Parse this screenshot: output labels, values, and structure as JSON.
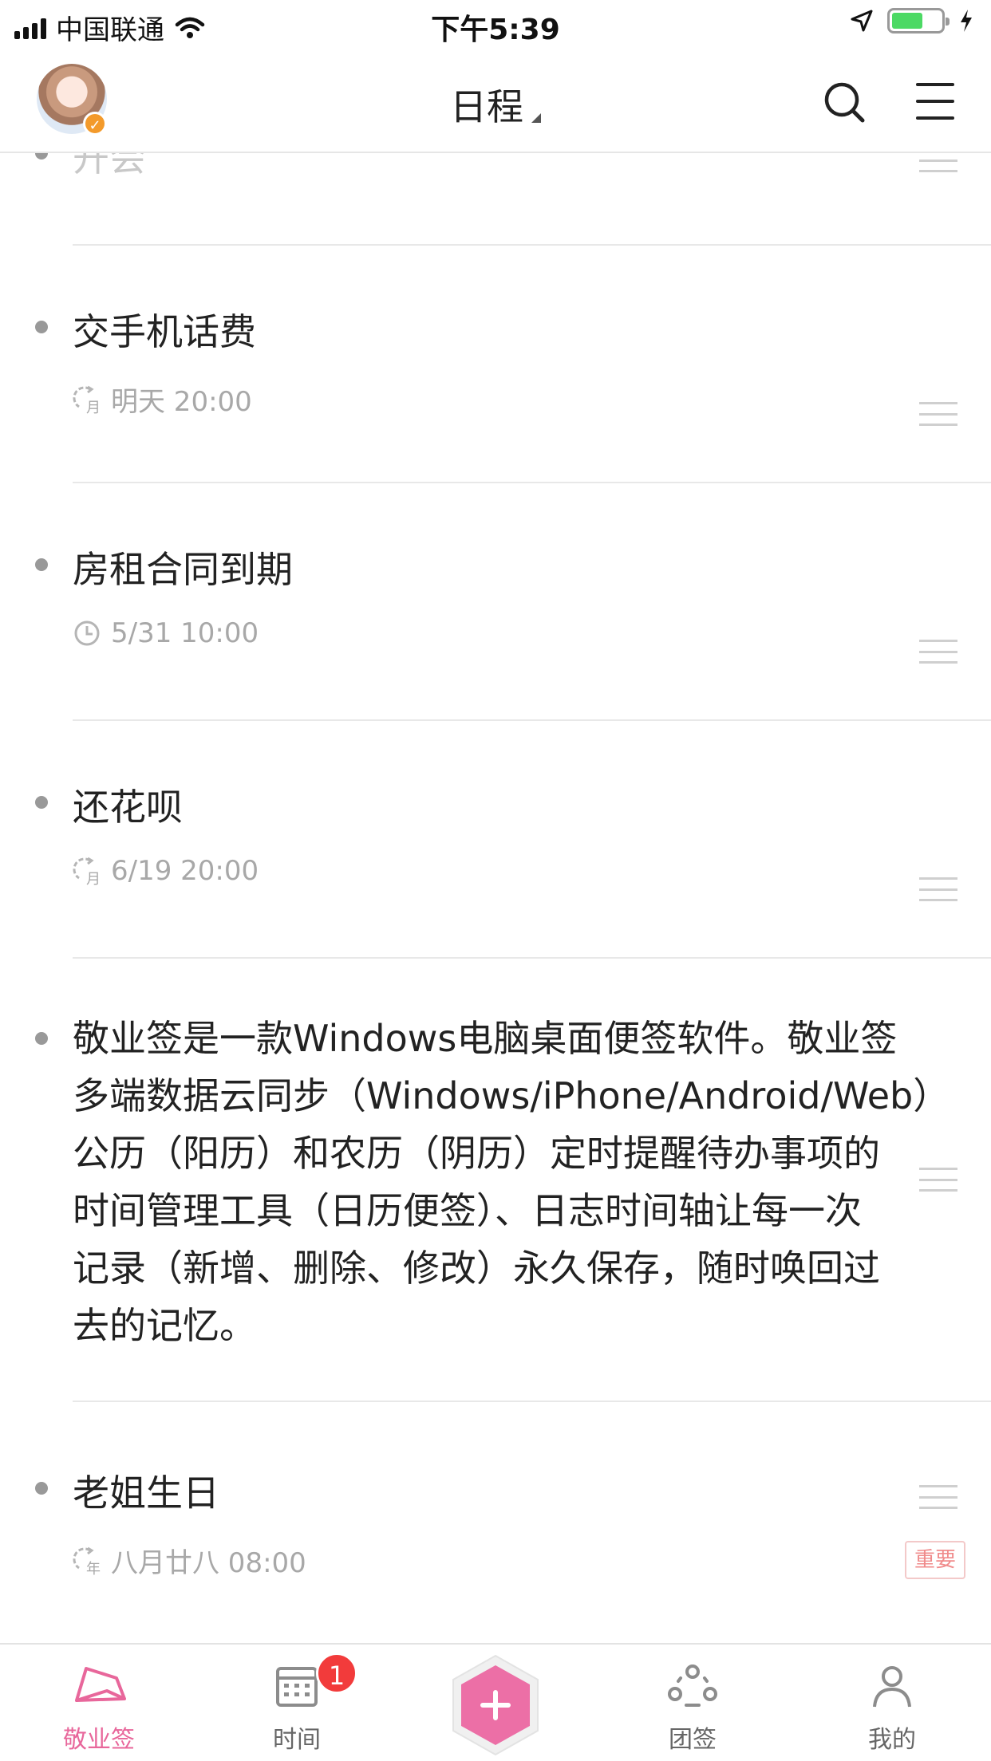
{
  "status_bar": {
    "carrier": "中国联通",
    "time": "下午5:39"
  },
  "nav": {
    "title": "日程",
    "avatar": "user-avatar"
  },
  "items": [
    {
      "title": "开会",
      "meta": ""
    },
    {
      "title": "交手机话费",
      "meta_icon": "repeat-monthly-icon",
      "meta_icon_text": "月",
      "meta": "明天 20:00"
    },
    {
      "title": "房租合同到期",
      "meta_icon": "clock-icon",
      "meta": "5/31 10:00"
    },
    {
      "title": "还花呗",
      "meta_icon": "repeat-monthly-icon",
      "meta_icon_text": "月",
      "meta": "6/19 20:00"
    },
    {
      "lines": [
        "敬业签是一款Windows电脑桌面便签软件。敬业签",
        "多端数据云同步（Windows/iPhone/Android/Web）",
        "公历（阳历）和农历（阴历）定时提醒待办事项的",
        "时间管理工具（日历便签）、日志时间轴让每一次",
        "记录（新增、删除、修改）永久保存，随时唤回过",
        "去的记忆。"
      ]
    },
    {
      "title": "老姐生日",
      "meta_icon": "repeat-yearly-icon",
      "meta_icon_text": "年",
      "meta": "八月廿八 08:00",
      "tag": "重要"
    }
  ],
  "tabbar": {
    "tabs": [
      {
        "label": "敬业签",
        "active": true
      },
      {
        "label": "时间",
        "badge": "1"
      },
      {
        "label": ""
      },
      {
        "label": "团签"
      },
      {
        "label": "我的"
      }
    ]
  },
  "colors": {
    "accent": "#e8679b",
    "badge": "#f23b3b",
    "battery": "#4cd964"
  }
}
